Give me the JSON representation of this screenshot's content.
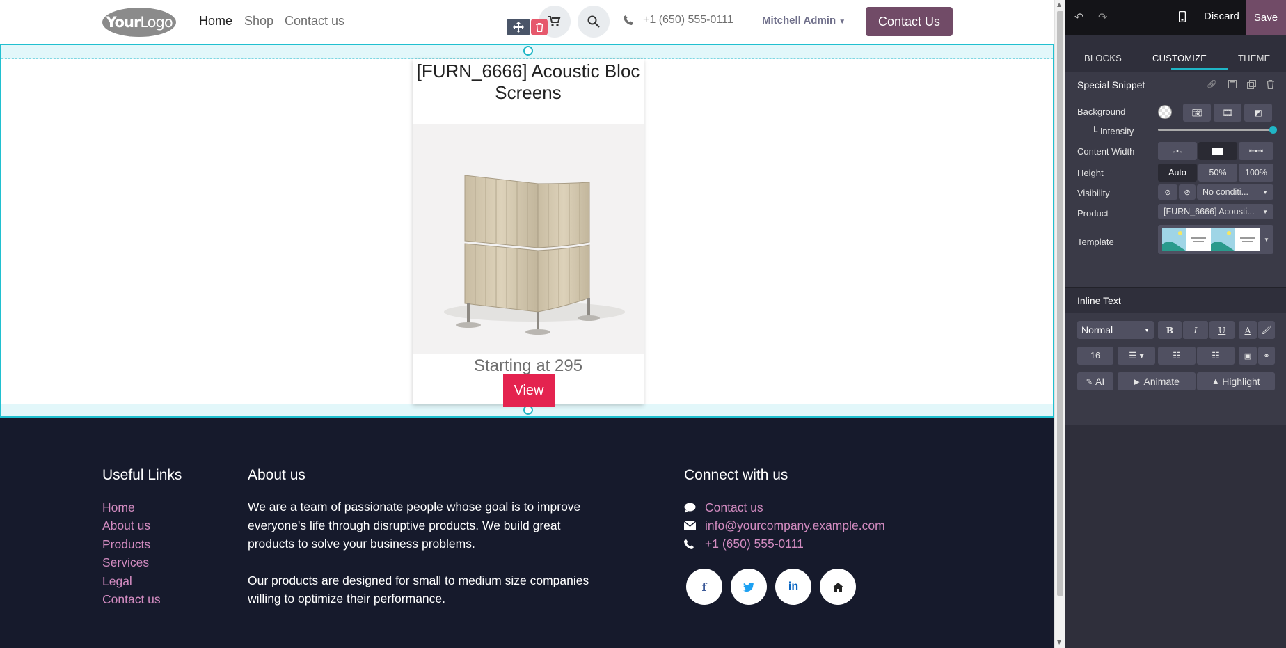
{
  "header": {
    "logo_bold": "Your",
    "logo_thin": "Logo",
    "nav": [
      "Home",
      "Shop",
      "Contact us"
    ],
    "phone": "+1 (650) 555-0111",
    "user": "Mitchell Admin",
    "contact_button": "Contact Us"
  },
  "snippet": {
    "product_title": "[FURN_6666] Acoustic Bloc Screens",
    "price": "Starting at 295",
    "view_button": "View"
  },
  "footer": {
    "useful_links_title": "Useful Links",
    "useful_links": [
      "Home",
      "About us",
      "Products",
      "Services",
      "Legal",
      "Contact us"
    ],
    "about_title": "About us",
    "about_p1": "We are a team of passionate people whose goal is to improve everyone's life through disruptive products. We build great products to solve your business problems.",
    "about_p2": "Our products are designed for small to medium size companies willing to optimize their performance.",
    "connect_title": "Connect with us",
    "contact_link": "Contact us",
    "email": "info@yourcompany.example.com",
    "phone": "+1 (650) 555-0111",
    "social": [
      "f",
      "t",
      "in",
      "home"
    ]
  },
  "panel": {
    "discard": "Discard",
    "save": "Save",
    "tabs": [
      "BLOCKS",
      "CUSTOMIZE",
      "THEME"
    ],
    "snippet_title": "Special Snippet",
    "background_label": "Background",
    "intensity_label": "└ Intensity",
    "intensity_value": 1.0,
    "content_width_label": "Content Width",
    "height_label": "Height",
    "height_options": [
      "Auto",
      "50%",
      "100%"
    ],
    "visibility_label": "Visibility",
    "visibility_value": "No conditi...",
    "product_label": "Product",
    "product_value": "[FURN_6666] Acousti...",
    "template_label": "Template",
    "inline_text_title": "Inline Text",
    "format_value": "Normal",
    "font_size": "16",
    "ai_button": "AI",
    "animate_button": "Animate",
    "highlight_button": "Highlight"
  },
  "colors": {
    "accent": "#714b67",
    "view_button": "#e4234f",
    "footer_bg": "#161a2c",
    "footer_link": "#d28bc0",
    "selection": "#20c0d0"
  }
}
